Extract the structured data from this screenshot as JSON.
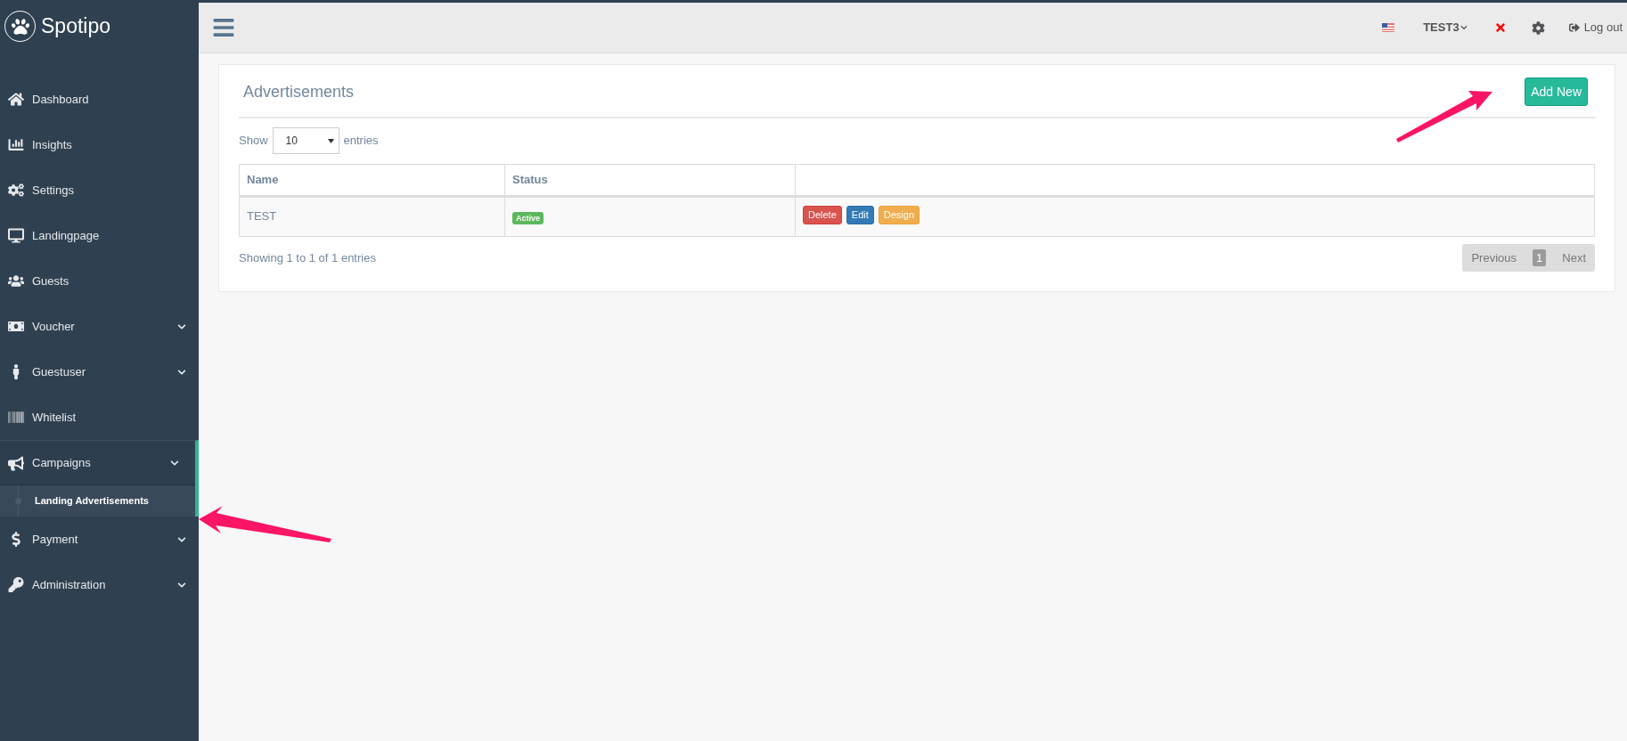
{
  "brand": {
    "name": "Spotipo"
  },
  "sidebar": {
    "items": [
      {
        "label": "Dashboard",
        "selected": false
      },
      {
        "label": "Insights",
        "selected": false
      },
      {
        "label": "Settings",
        "selected": false
      },
      {
        "label": "Landingpage",
        "selected": false
      },
      {
        "label": "Guests",
        "selected": false
      },
      {
        "label": "Voucher",
        "selected": false,
        "expanded": false
      },
      {
        "label": "Guestuser",
        "selected": false,
        "expanded": false
      },
      {
        "label": "Whitelist",
        "selected": false
      },
      {
        "label": "Campaigns",
        "selected": true,
        "expanded": true,
        "children": [
          {
            "label": "Landing Advertisements",
            "selected": true
          }
        ]
      },
      {
        "label": "Payment",
        "selected": false,
        "expanded": false
      },
      {
        "label": "Administration",
        "selected": false,
        "expanded": false
      }
    ]
  },
  "topbar": {
    "user": "TEST3",
    "logout": "Log out"
  },
  "panel": {
    "title": "Advertisements",
    "add_button": "Add New",
    "length": {
      "before": "Show",
      "value": "10",
      "after": "entries"
    },
    "table": {
      "columns": [
        "Name",
        "Status"
      ],
      "rows": [
        {
          "name": "TEST",
          "status": "Active",
          "actions": [
            {
              "label": "Delete",
              "kind": "danger"
            },
            {
              "label": "Edit",
              "kind": "primary"
            },
            {
              "label": "Design",
              "kind": "warning"
            }
          ]
        }
      ]
    },
    "info": "Showing 1 to 1 of 1 entries",
    "pagination": {
      "previous": "Previous",
      "pages": [
        {
          "label": "1",
          "selected": true
        }
      ],
      "next": "Next"
    }
  }
}
